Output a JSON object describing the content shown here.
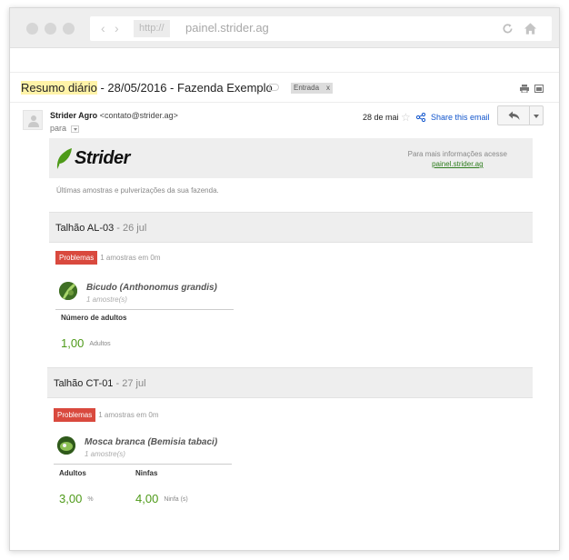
{
  "browser": {
    "url_prefix": "http://",
    "url": "painel.strider.ag"
  },
  "email": {
    "subject_highlight": "Resumo diário",
    "subject_rest": " - 28/05/2016 - Fazenda Exemplo",
    "label_tag": "Entrada",
    "label_tag_close": "x",
    "sender_name": "Strider Agro",
    "sender_email": "<contato@strider.ag>",
    "to_label": "para",
    "date": "28 de mai",
    "share_label": "Share this email"
  },
  "body": {
    "brand_name": "Strider",
    "more_info_text": "Para mais informações acesse",
    "more_info_link": "painel.strider.ag",
    "intro": "Últimas amostras e pulverizações da sua fazenda.",
    "plots": [
      {
        "name": "Talhão AL-03",
        "separator": " - ",
        "date": "26 jul",
        "badge": "Problemas",
        "samples_text": "1 amostras em 0m",
        "species_name": "Bicudo (Anthonomus grandis)",
        "species_count": "1 amostre(s)",
        "metrics": [
          {
            "label": "Número de adultos",
            "value": "1,00",
            "unit": "Adultos"
          }
        ]
      },
      {
        "name": "Talhão CT-01",
        "separator": " - ",
        "date": "27 jul",
        "badge": "Problemas",
        "samples_text": "1 amostras em 0m",
        "species_name": "Mosca branca (Bemisia tabaci)",
        "species_count": "1 amostre(s)",
        "metrics": [
          {
            "label": "Adultos",
            "value": "3,00",
            "unit": "%"
          },
          {
            "label": "Ninfas",
            "value": "4,00",
            "unit": "Ninfa (s)"
          }
        ]
      }
    ]
  },
  "colors": {
    "accent_green": "#4e9a19",
    "problem_red": "#d9493e",
    "link_blue": "#1155cc",
    "highlight_yellow": "#fff3a8"
  }
}
